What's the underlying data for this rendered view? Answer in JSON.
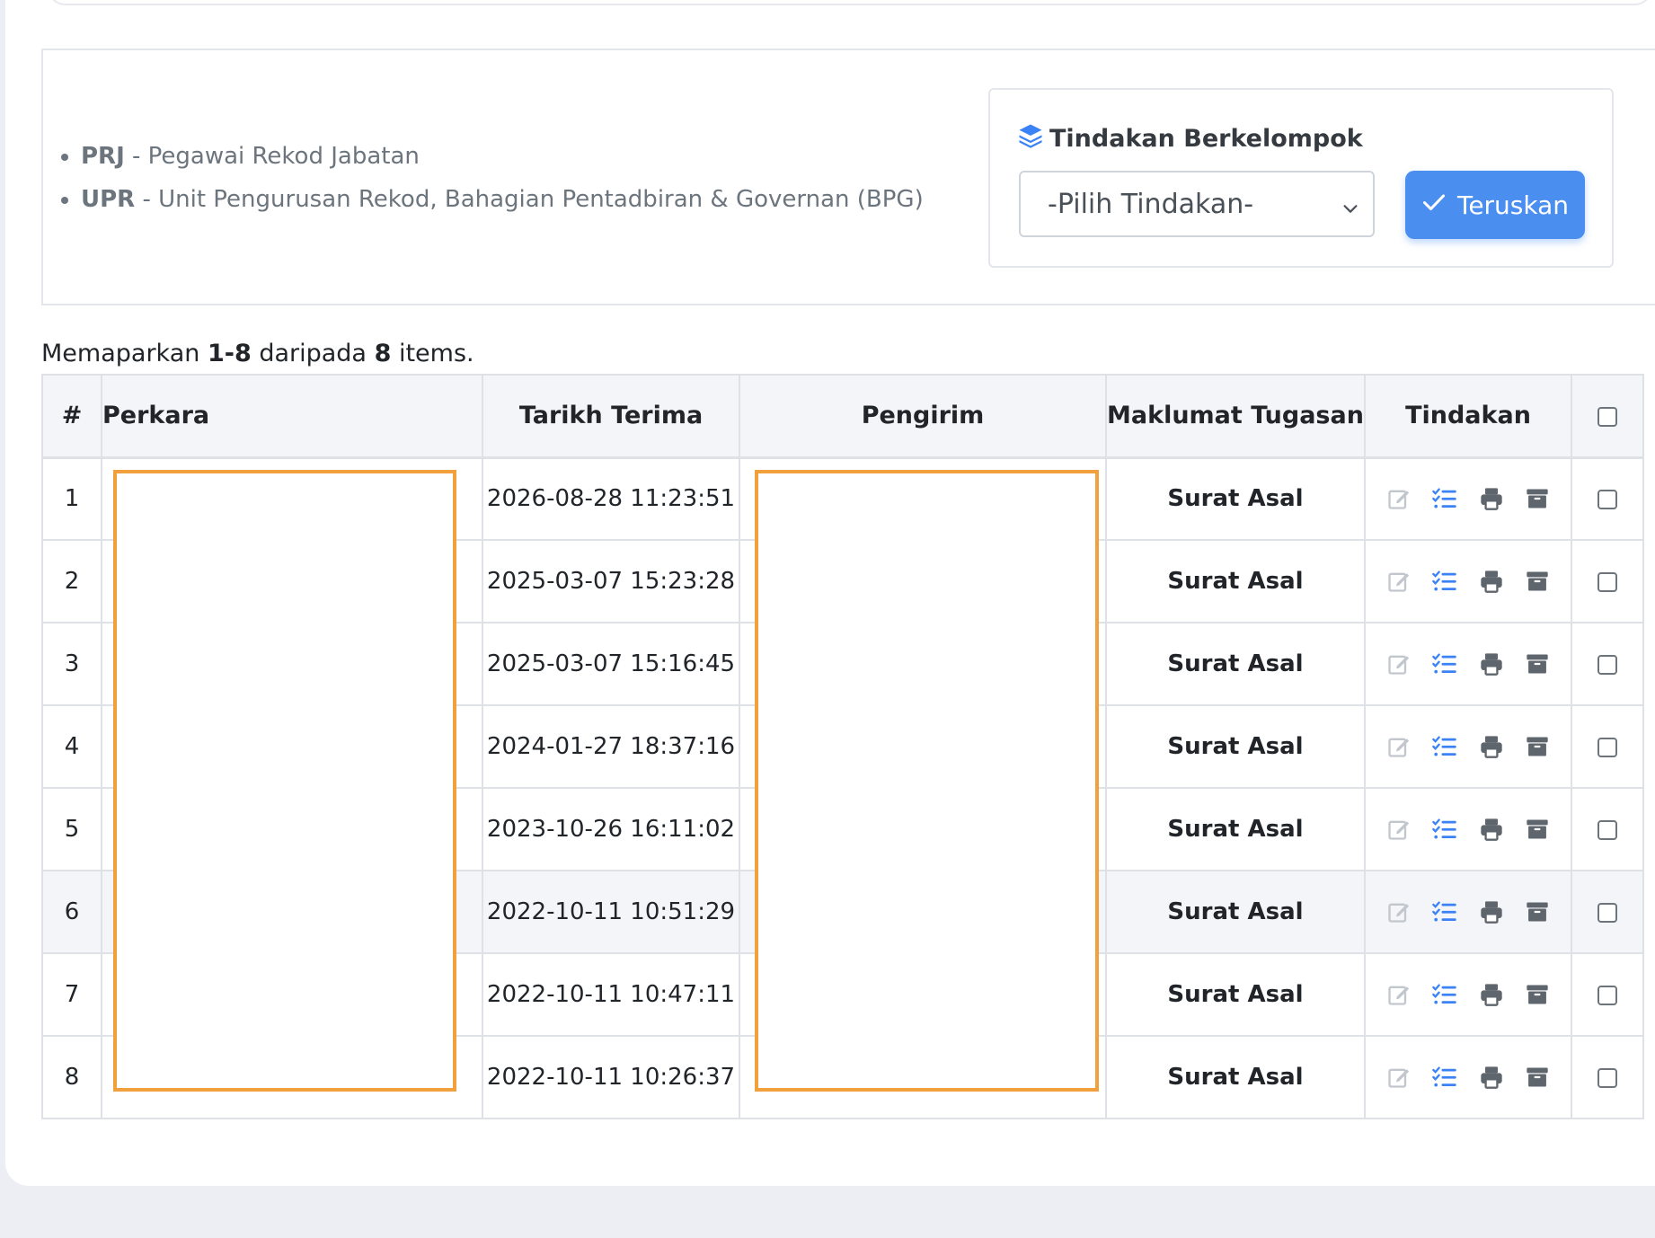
{
  "legend": [
    {
      "code": "PRJ",
      "text": " - Pegawai Rekod Jabatan"
    },
    {
      "code": "UPR",
      "text": " - Unit Pengurusan Rekod, Bahagian Pentadbiran & Governan (BPG)"
    }
  ],
  "bulk": {
    "title": "Tindakan Berkelompok",
    "select_value": "-Pilih Tindakan-",
    "button_label": "Teruskan"
  },
  "summary": {
    "prefix": "Memaparkan ",
    "range": "1-8",
    "mid": " daripada ",
    "total": "8",
    "suffix": " items."
  },
  "table": {
    "headers": {
      "num": "#",
      "perkara": "Perkara",
      "tarikh": "Tarikh Terima",
      "pengirim": "Pengirim",
      "maklumat": "Maklumat Tugasan",
      "tindakan": "Tindakan"
    },
    "rows": [
      {
        "num": "1",
        "tarikh": "2026-08-28 11:23:51",
        "maklumat": "Surat Asal"
      },
      {
        "num": "2",
        "tarikh": "2025-03-07 15:23:28",
        "maklumat": "Surat Asal"
      },
      {
        "num": "3",
        "tarikh": "2025-03-07 15:16:45",
        "maklumat": "Surat Asal"
      },
      {
        "num": "4",
        "tarikh": "2024-01-27 18:37:16",
        "maklumat": "Surat Asal"
      },
      {
        "num": "5",
        "tarikh": "2023-10-26 16:11:02",
        "maklumat": "Surat Asal"
      },
      {
        "num": "6",
        "tarikh": "2022-10-11 10:51:29",
        "maklumat": "Surat Asal"
      },
      {
        "num": "7",
        "tarikh": "2022-10-11 10:47:11",
        "maklumat": "Surat Asal"
      },
      {
        "num": "8",
        "tarikh": "2022-10-11 10:26:37",
        "maklumat": "Surat Asal"
      }
    ],
    "row_icons": [
      "edit-icon",
      "task-list-icon",
      "print-icon",
      "archive-icon"
    ]
  },
  "colors": {
    "accent": "#4a8ef0",
    "link": "#3b82f6",
    "redaction_border": "#f0a03c"
  }
}
